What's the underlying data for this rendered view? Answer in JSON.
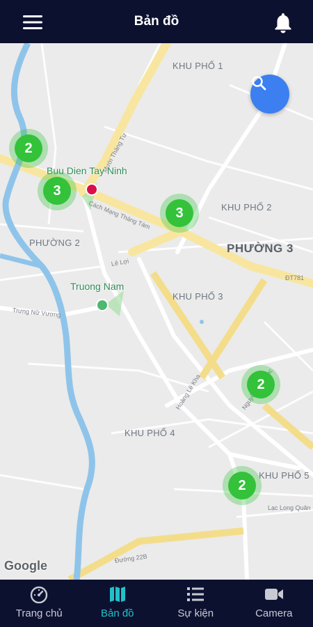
{
  "header": {
    "title": "Bản đồ",
    "menu_icon": "hamburger-menu-icon",
    "notification_icon": "bell-icon"
  },
  "map": {
    "areas": [
      {
        "name": "KHU PHỐ 1"
      },
      {
        "name": "KHU PHỐ 2"
      },
      {
        "name": "PHƯỜNG 3"
      },
      {
        "name": "PHƯỜNG 2"
      },
      {
        "name": "KHU PHỐ 3"
      },
      {
        "name": "KHU PHỐ 4"
      },
      {
        "name": "KHU PHỐ 5"
      }
    ],
    "pois": [
      {
        "name": "Buu Dien Tay Ninh"
      },
      {
        "name": "Truong Nam"
      }
    ],
    "streets": [
      {
        "name": "Cách Mạng Tháng Tám"
      },
      {
        "name": "Mười Tháng Tư"
      },
      {
        "name": "Lê Lợi"
      },
      {
        "name": "Trưng Nữ Vương"
      },
      {
        "name": "Hoàng Lê Kha"
      },
      {
        "name": "ĐT781"
      },
      {
        "name": "Đường 22B"
      },
      {
        "name": "Lạc Long Quân"
      },
      {
        "name": "Nguyễn Thái Học"
      }
    ],
    "clusters": [
      {
        "count": "2"
      },
      {
        "count": "3"
      },
      {
        "count": "3"
      },
      {
        "count": "2"
      },
      {
        "count": "2"
      }
    ],
    "search_icon": "search-icon",
    "attribution": "Google"
  },
  "tabs": [
    {
      "label": "Trang chủ",
      "icon": "speedometer-icon",
      "active": false
    },
    {
      "label": "Bản đồ",
      "icon": "map-icon",
      "active": true
    },
    {
      "label": "Sự kiện",
      "icon": "list-icon",
      "active": false
    },
    {
      "label": "Camera",
      "icon": "video-camera-icon",
      "active": false
    }
  ],
  "colors": {
    "header_bg": "#0d1130",
    "active_tab": "#1fc2c9",
    "cluster": "#33c23a",
    "fab": "#3b7ff0",
    "river": "#8fc4ea",
    "major_road": "#f8e6a0"
  }
}
